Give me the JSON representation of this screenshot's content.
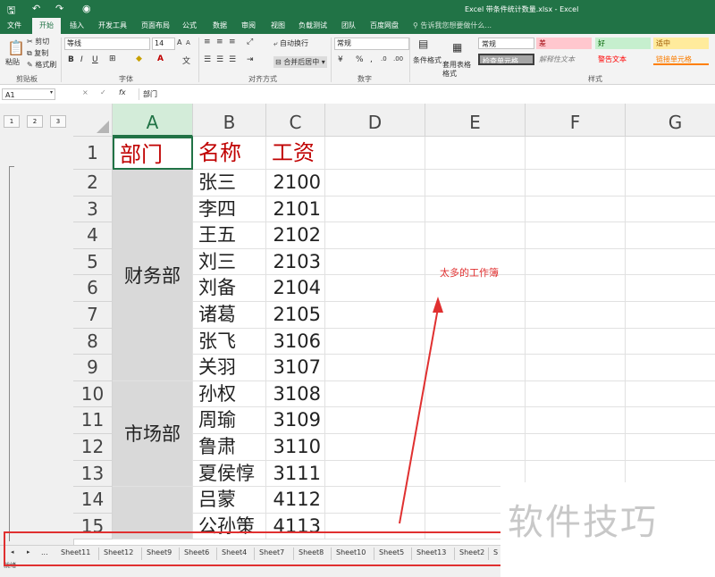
{
  "title_bar": {
    "title": "Excel 带条件统计数量.xlsx - Excel",
    "quick_access": [
      "save-icon",
      "undo-icon",
      "redo-icon",
      "camera-icon"
    ]
  },
  "ribbon_tabs": [
    "文件",
    "开始",
    "插入",
    "开发工具",
    "页面布局",
    "公式",
    "数据",
    "审阅",
    "视图",
    "负载测试",
    "团队",
    "百度网盘"
  ],
  "active_tab": "开始",
  "tell_me": "告诉我您想要做什么...",
  "clipboard": {
    "paste": "粘贴",
    "cut": "剪切",
    "copy": "复制",
    "format_painter": "格式刷",
    "label": "剪贴板"
  },
  "font": {
    "name": "等线",
    "size": "14",
    "label": "字体"
  },
  "alignment": {
    "wrap": "自动换行",
    "merge": "合并后居中",
    "label": "对齐方式"
  },
  "number": {
    "format": "常规",
    "label": "数字"
  },
  "styles": {
    "conditional": "条件格式",
    "table": "套用表格格式",
    "normal": "常规",
    "bad": "差",
    "good": "好",
    "neutral": "适中",
    "check_cell": "检查单元格",
    "explanatory": "解释性文本",
    "warning": "警告文本",
    "linked": "链接单元格",
    "label": "样式"
  },
  "formula_bar": {
    "name_box": "A1",
    "cancel": "×",
    "enter": "✓",
    "fx": "fx",
    "content": "部门"
  },
  "outline_levels": [
    "1",
    "2",
    "3"
  ],
  "columns": [
    "A",
    "B",
    "C",
    "D",
    "E",
    "F",
    "G"
  ],
  "rows": [
    "1",
    "2",
    "3",
    "4",
    "5",
    "6",
    "7",
    "8",
    "9",
    "10",
    "11",
    "12",
    "13",
    "14",
    "15"
  ],
  "headers": {
    "dept": "部门",
    "name": "名称",
    "salary": "工资"
  },
  "records": [
    {
      "name": "张三",
      "salary": "2100"
    },
    {
      "name": "李四",
      "salary": "2101"
    },
    {
      "name": "王五",
      "salary": "2102"
    },
    {
      "name": "刘三",
      "salary": "2103"
    },
    {
      "name": "刘备",
      "salary": "2104"
    },
    {
      "name": "诸葛",
      "salary": "2105"
    },
    {
      "name": "张飞",
      "salary": "3106"
    },
    {
      "name": "关羽",
      "salary": "3107"
    },
    {
      "name": "孙权",
      "salary": "3108"
    },
    {
      "name": "周瑜",
      "salary": "3109"
    },
    {
      "name": "鲁肃",
      "salary": "3110"
    },
    {
      "name": "夏侯惇",
      "salary": "3111"
    },
    {
      "name": "吕蒙",
      "salary": "4112"
    },
    {
      "name": "公孙策",
      "salary": "4113"
    }
  ],
  "merged_depts": [
    "财务部",
    "市场部"
  ],
  "sheet_tabs": [
    "Sheet11",
    "Sheet12",
    "Sheet9",
    "Sheet6",
    "Sheet4",
    "Sheet7",
    "Sheet8",
    "Sheet10",
    "Sheet5",
    "Sheet13",
    "Sheet2",
    "S"
  ],
  "sheet_nav": {
    "prev": "◂",
    "next": "▸",
    "more": "..."
  },
  "status": "就绪",
  "annotation": "太多的工作簿",
  "watermark": "软件技巧",
  "colors": {
    "excel_green": "#217346",
    "header_red": "#c00000",
    "annotation_red": "#e03030",
    "merged_gray": "#d9d9d9"
  }
}
